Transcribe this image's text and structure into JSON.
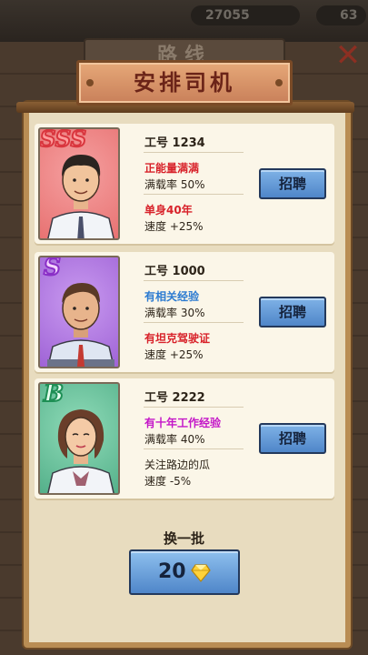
{
  "hud": {
    "coins": "27055",
    "gems": "63"
  },
  "background": {
    "tab_title": "路线"
  },
  "dialog": {
    "title": "安排司机"
  },
  "candidates": [
    {
      "rank": "SSS",
      "id_line": "工号 1234",
      "trait1": "正能量满满",
      "load_rate": "满载率 50%",
      "trait2": "单身40年",
      "speed": "速度 +25%",
      "hire_label": "招聘"
    },
    {
      "rank": "S",
      "id_line": "工号 1000",
      "trait1": "有相关经验",
      "load_rate": "满载率 30%",
      "trait2": "有坦克驾驶证",
      "speed": "速度 +25%",
      "hire_label": "招聘"
    },
    {
      "rank": "B",
      "id_line": "工号 2222",
      "trait1": "有十年工作经验",
      "load_rate": "满载率 40%",
      "trait2": "关注路边的瓜",
      "speed": "速度 -5%",
      "hire_label": "招聘"
    }
  ],
  "refresh": {
    "label": "换一批",
    "cost": "20",
    "icon": "gem-icon"
  },
  "colors": {
    "trait_red": "#d8222a",
    "trait_blue": "#2c7bd1",
    "trait_magenta": "#c417c8",
    "button_blue": "#4f86c9"
  }
}
